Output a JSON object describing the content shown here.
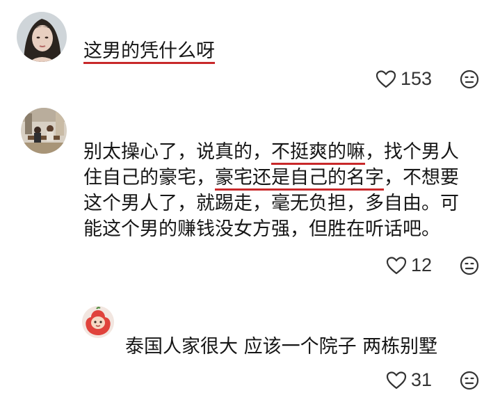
{
  "comments": [
    {
      "segments": [
        {
          "text": "这男的凭什么呀",
          "underline": true
        }
      ],
      "likes": "153"
    },
    {
      "lines": [
        [
          {
            "text": "别太操心了，说真的，",
            "underline": false
          },
          {
            "text": "不挺爽的嘛",
            "underline": true
          },
          {
            "text": "，找个男人",
            "underline": false
          }
        ],
        [
          {
            "text": "住自己的豪宅，",
            "underline": false
          },
          {
            "text": "豪宅还是自己的名字",
            "underline": true
          },
          {
            "text": "，不想要",
            "underline": false
          }
        ],
        [
          {
            "text": "这个男人了，就踢走，毫无负担，多自由。可",
            "underline": false
          }
        ],
        [
          {
            "text": "能这个男的赚钱没女方强，但胜在听话吧。",
            "underline": false
          }
        ]
      ],
      "likes": "12"
    },
    {
      "segments": [
        {
          "text": "泰国人家很大  应该一个院子  两栋别墅",
          "underline": false
        }
      ],
      "likes": "31"
    }
  ],
  "icons": {
    "like": "heart-outline-icon",
    "dislike": "neutral-face-icon"
  },
  "colors": {
    "underline": "#c8282a",
    "text": "#161616",
    "count": "#333333"
  }
}
